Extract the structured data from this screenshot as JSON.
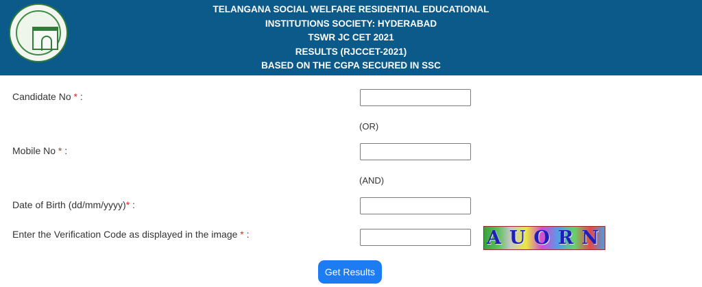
{
  "header": {
    "line1": "TELANGANA SOCIAL WELFARE RESIDENTIAL EDUCATIONAL",
    "line2": "INSTITUTIONS SOCIETY: HYDERABAD",
    "line3": "TSWR JC CET 2021",
    "line4": "RESULTS (RJCCET-2021)",
    "line5": "BASED ON THE CGPA SECURED IN SSC",
    "logo_icon": "telangana-emblem-icon"
  },
  "form": {
    "candidate_no": {
      "label": "Candidate No",
      "required_mark": " *",
      "suffix": " :",
      "value": ""
    },
    "or_text": "(OR)",
    "mobile_no": {
      "label": "Mobile No",
      "required_mark": " *",
      "suffix": " :",
      "value": ""
    },
    "and_text": "(AND)",
    "dob": {
      "label": "Date of Birth (dd/mm/yyyy)",
      "required_mark": "*",
      "suffix": " :",
      "value": ""
    },
    "verification": {
      "label": "Enter the Verification Code as displayed in the image",
      "required_mark": " *",
      "suffix": " :",
      "value": ""
    },
    "captcha_text": "AUORNR",
    "submit_label": "Get Results"
  },
  "colors": {
    "header_bg": "#0b5a8a",
    "button_bg": "#1e7cf2",
    "required": "#e02424"
  }
}
